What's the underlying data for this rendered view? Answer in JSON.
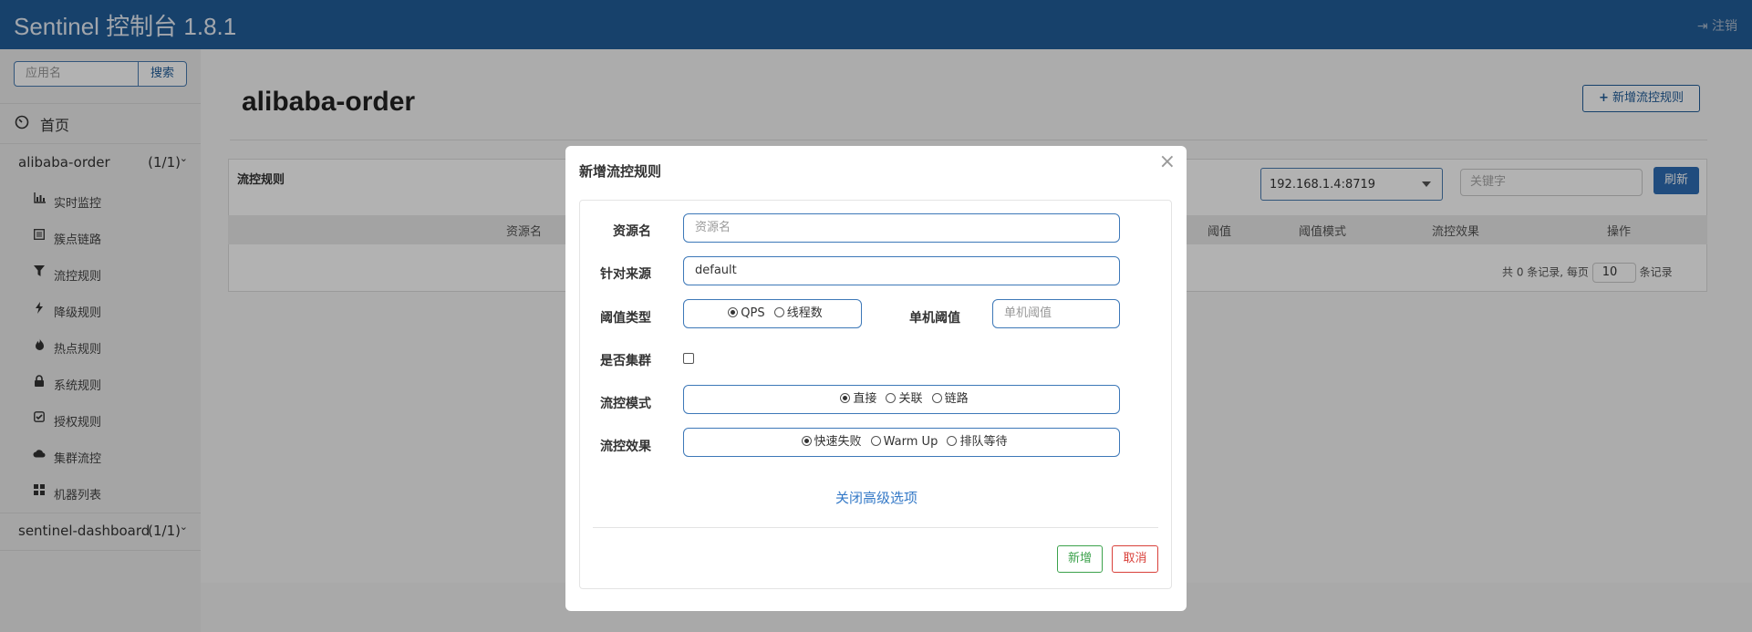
{
  "header": {
    "brand": "Sentinel 控制台 1.8.1",
    "logout_label": "注销"
  },
  "sidebar": {
    "search_placeholder": "应用名",
    "search_button": "搜索",
    "home_label": "首页",
    "apps": [
      {
        "name": "alibaba-order",
        "count": "(1/1)"
      },
      {
        "name": "sentinel-dashboard",
        "count": "(1/1)"
      }
    ],
    "submenu": [
      {
        "label": "实时监控",
        "icon": "bar-chart-icon"
      },
      {
        "label": "簇点链路",
        "icon": "list-icon"
      },
      {
        "label": "流控规则",
        "icon": "filter-icon"
      },
      {
        "label": "降级规则",
        "icon": "lightning-icon"
      },
      {
        "label": "热点规则",
        "icon": "fire-icon"
      },
      {
        "label": "系统规则",
        "icon": "lock-icon"
      },
      {
        "label": "授权规则",
        "icon": "check-square-icon"
      },
      {
        "label": "集群流控",
        "icon": "cloud-icon"
      },
      {
        "label": "机器列表",
        "icon": "grid-icon"
      }
    ]
  },
  "main": {
    "title": "alibaba-order",
    "add_rule_button": "新增流控规则",
    "panel_title": "流控规则",
    "machine_select": "192.168.1.4:8719",
    "keyword_placeholder": "关键字",
    "refresh_button": "刷新",
    "columns": [
      "资源名",
      "阈值",
      "阈值模式",
      "流控效果",
      "操作"
    ],
    "pager": {
      "prefix": "共 0 条记录, 每页",
      "page_size": "10",
      "suffix": "条记录"
    }
  },
  "modal": {
    "title": "新增流控规则",
    "close": "×",
    "resource_label": "资源名",
    "resource_placeholder": "资源名",
    "source_label": "针对来源",
    "source_value": "default",
    "threshold_type_label": "阈值类型",
    "threshold_type_options": [
      "QPS",
      "线程数"
    ],
    "single_threshold_label": "单机阈值",
    "single_threshold_placeholder": "单机阈值",
    "cluster_label": "是否集群",
    "mode_label": "流控模式",
    "mode_options": [
      "直接",
      "关联",
      "链路"
    ],
    "effect_label": "流控效果",
    "effect_options": [
      "快速失败",
      "Warm Up",
      "排队等待"
    ],
    "advanced_link": "关闭高级选项",
    "add_button": "新增",
    "cancel_button": "取消"
  }
}
